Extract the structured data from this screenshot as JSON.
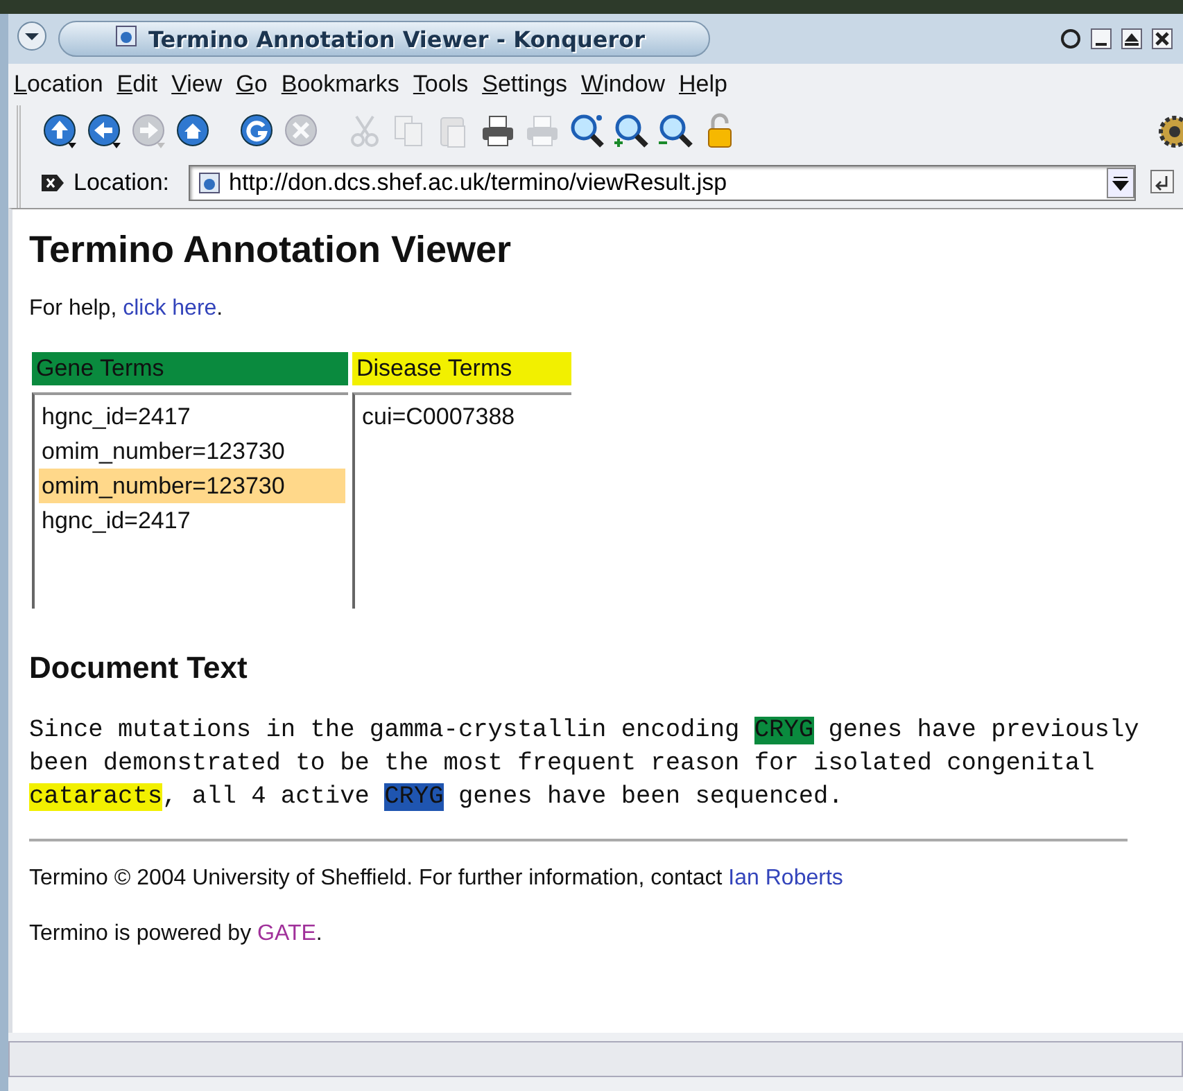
{
  "window": {
    "title": "Termino Annotation Viewer - Konqueror"
  },
  "menu": [
    "Location",
    "Edit",
    "View",
    "Go",
    "Bookmarks",
    "Tools",
    "Settings",
    "Window",
    "Help"
  ],
  "toolbar": [
    {
      "kind": "up",
      "disabled": false
    },
    {
      "kind": "back",
      "disabled": false
    },
    {
      "kind": "forward",
      "disabled": true
    },
    {
      "kind": "home",
      "disabled": false
    },
    {
      "kind": "reload",
      "disabled": false
    },
    {
      "kind": "stop",
      "disabled": true
    },
    {
      "kind": "cut",
      "disabled": true
    },
    {
      "kind": "copy",
      "disabled": true
    },
    {
      "kind": "paste",
      "disabled": true
    },
    {
      "kind": "print",
      "disabled": false
    },
    {
      "kind": "preview",
      "disabled": true
    },
    {
      "kind": "zoom",
      "disabled": false
    },
    {
      "kind": "zoomin",
      "disabled": false
    },
    {
      "kind": "zoomout",
      "disabled": false
    },
    {
      "kind": "lock",
      "disabled": false
    }
  ],
  "location": {
    "label": "Location:",
    "url": "http://don.dcs.shef.ac.uk/termino/viewResult.jsp"
  },
  "page": {
    "heading": "Termino Annotation Viewer",
    "help": {
      "text": "For help, ",
      "link": "click here",
      "after": "."
    },
    "term_lists": [
      {
        "title": "Gene Terms",
        "color": "#0a8a3e",
        "items": [
          {
            "text": "hgnc_id=2417",
            "selected": false
          },
          {
            "text": "omim_number=123730",
            "selected": false
          },
          {
            "text": "omim_number=123730",
            "selected": true
          },
          {
            "text": "hgnc_id=2417",
            "selected": false
          }
        ]
      },
      {
        "title": "Disease Terms",
        "color": "#f2f000",
        "items": [
          {
            "text": "cui=C0007388",
            "selected": false
          }
        ]
      }
    ],
    "document_heading": "Document Text",
    "document_text": [
      {
        "text": "Since mutations in the gamma-crystallin encoding "
      },
      {
        "text": "CRYG",
        "color": "#0a8a3e"
      },
      {
        "text": " genes have previously been demonstrated to be the most frequent reason for isolated congenital "
      },
      {
        "text": "cataracts",
        "color": "#f2f000"
      },
      {
        "text": ", all 4 active "
      },
      {
        "text": "CRYG",
        "color": "#1f55b0"
      },
      {
        "text": " genes have been sequenced."
      }
    ],
    "footer": [
      {
        "text": "Termino © 2004 University of Sheffield. For further information, contact ",
        "link": "Ian Roberts",
        "visited": false
      },
      {
        "text": "Termino is powered by ",
        "link": "GATE",
        "visited": true,
        "after": "."
      }
    ]
  }
}
